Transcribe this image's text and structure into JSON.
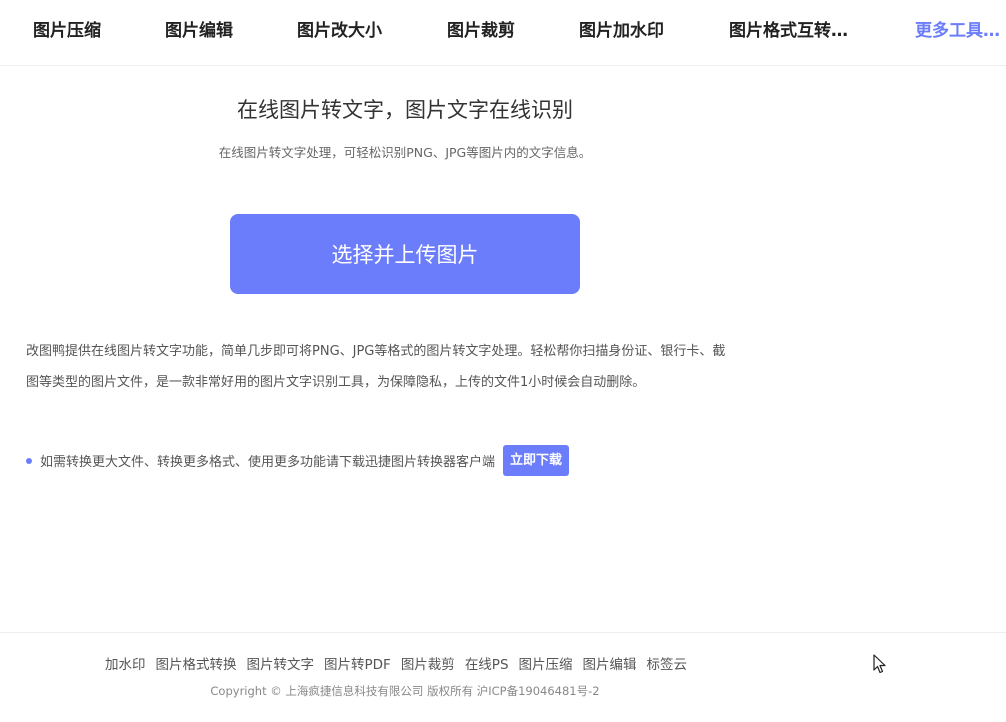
{
  "nav": {
    "items": [
      "图片压缩",
      "图片编辑",
      "图片改大小",
      "图片裁剪",
      "图片加水印",
      "图片格式互转…"
    ],
    "more": "更多工具…"
  },
  "hero": {
    "title": "在线图片转文字，图片文字在线识别",
    "subtitle": "在线图片转文字处理，可轻松识别PNG、JPG等图片内的文字信息。",
    "upload_label": "选择并上传图片"
  },
  "description": {
    "line1": "改图鸭提供在线图片转文字功能，简单几步即可将PNG、JPG等格式的图片转文字处理。轻松帮你扫描身份证、银行卡、截",
    "line2": "图等类型的图片文件，是一款非常好用的图片文字识别工具，为保障隐私，上传的文件1小时候会自动删除。"
  },
  "tip": {
    "text": "如需转换更大文件、转换更多格式、使用更多功能请下载迅捷图片转换器客户端",
    "download_label": "立即下载"
  },
  "footer": {
    "links": [
      "加水印",
      "图片格式转换",
      "图片转文字",
      "图片转PDF",
      "图片裁剪",
      "在线PS",
      "图片压缩",
      "图片编辑",
      "标签云"
    ],
    "copyright": "Copyright © 上海疯捷信息科技有限公司 版权所有 沪ICP备19046481号-2"
  },
  "colors": {
    "accent": "#6c7dfb"
  }
}
